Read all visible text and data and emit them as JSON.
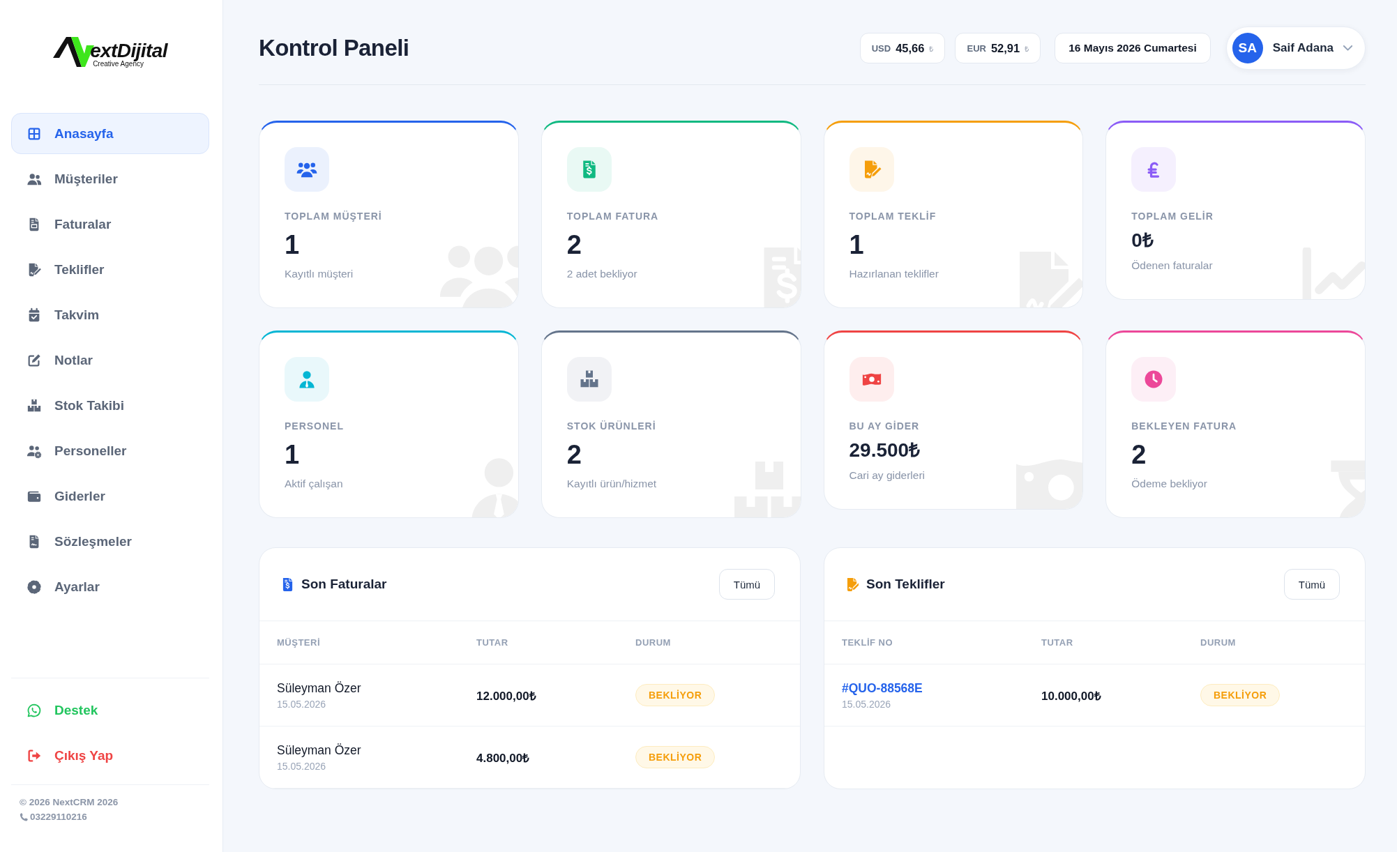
{
  "sidebar": {
    "logo": {
      "wordmark": "extDijital",
      "tagline": "Creative Agency"
    },
    "nav": [
      {
        "label": "Anasayfa",
        "selected": true
      },
      {
        "label": "Müşteriler",
        "selected": false
      },
      {
        "label": "Faturalar",
        "selected": false
      },
      {
        "label": "Teklifler",
        "selected": false
      },
      {
        "label": "Takvim",
        "selected": false
      },
      {
        "label": "Notlar",
        "selected": false
      },
      {
        "label": "Stok Takibi",
        "selected": false
      },
      {
        "label": "Personeller",
        "selected": false
      },
      {
        "label": "Giderler",
        "selected": false
      },
      {
        "label": "Sözleşmeler",
        "selected": false
      },
      {
        "label": "Ayarlar",
        "selected": false
      }
    ],
    "actions": [
      {
        "label": "Destek",
        "kind": "support"
      },
      {
        "label": "Çıkış Yap",
        "kind": "logout"
      }
    ],
    "footer": {
      "copyright": "© 2026 NextCRM 2026",
      "phone": "03229110216"
    }
  },
  "header": {
    "title": "Kontrol Paneli",
    "rates": [
      {
        "code": "USD",
        "value": "45,66",
        "symbol": "₺"
      },
      {
        "code": "EUR",
        "value": "52,91",
        "symbol": "₺"
      }
    ],
    "date": "16 Mayıs 2026 Cumartesi",
    "user": {
      "initials": "SA",
      "name": "Saif Adana"
    }
  },
  "stats": [
    {
      "label": "TOPLAM MÜŞTERİ",
      "value": "1",
      "note": "Kayıtlı müşteri",
      "color": "#2563eb",
      "kind": "count"
    },
    {
      "label": "TOPLAM FATURA",
      "value": "2",
      "note": "2 adet bekliyor",
      "color": "#10b981",
      "kind": "count"
    },
    {
      "label": "TOPLAM TEKLİF",
      "value": "1",
      "note": "Hazırlanan teklifler",
      "color": "#f59e0b",
      "kind": "count"
    },
    {
      "label": "TOPLAM GELİR",
      "value": "0₺",
      "note": "Ödenen faturalar",
      "color": "#8b5cf6",
      "kind": "amount"
    },
    {
      "label": "PERSONEL",
      "value": "1",
      "note": "Aktif çalışan",
      "color": "#06b6d4",
      "kind": "count"
    },
    {
      "label": "STOK ÜRÜNLERİ",
      "value": "2",
      "note": "Kayıtlı ürün/hizmet",
      "color": "#64748b",
      "kind": "count"
    },
    {
      "label": "BU AY GİDER",
      "value": "29.500₺",
      "note": "Cari ay giderleri",
      "color": "#ef4444",
      "kind": "amount"
    },
    {
      "label": "BEKLEYEN FATURA",
      "value": "2",
      "note": "Ödeme bekliyor",
      "color": "#ec4899",
      "kind": "count"
    }
  ],
  "invoices": {
    "title": "Son Faturalar",
    "button": "Tümü",
    "columns": [
      "MÜŞTERİ",
      "TUTAR",
      "DURUM"
    ],
    "rows": [
      {
        "customer": "Süleyman Özer",
        "date": "15.05.2026",
        "amount": "12.000,00₺",
        "status": "BEKLİYOR"
      },
      {
        "customer": "Süleyman Özer",
        "date": "15.05.2026",
        "amount": "4.800,00₺",
        "status": "BEKLİYOR"
      }
    ]
  },
  "quotes": {
    "title": "Son Teklifler",
    "button": "Tümü",
    "columns": [
      "TEKLİF NO",
      "TUTAR",
      "DURUM"
    ],
    "rows": [
      {
        "number": "#QUO-88568E",
        "date": "15.05.2026",
        "amount": "10.000,00₺",
        "status": "BEKLİYOR"
      }
    ]
  }
}
